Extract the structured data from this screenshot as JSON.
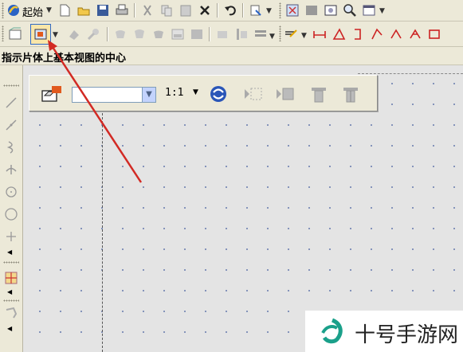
{
  "toolbar_top": {
    "start_label": "起始",
    "icons": [
      "nx-logo-icon",
      "new-file-icon",
      "open-folder-icon",
      "save-icon",
      "print-icon",
      "cut-icon",
      "copy-icon",
      "paste-icon",
      "delete-icon",
      "undo-icon",
      "command-finder-icon",
      "zoom-fit-icon",
      "layer-icon",
      "view-icon",
      "zoom-icon",
      "window-icon"
    ]
  },
  "toolbar_second": {
    "icons": [
      "new-sheet-icon",
      "base-view-icon",
      "projected-view-icon",
      "detail-view-icon",
      "section-view-icon",
      "break-view-icon",
      "view-boundary-icon",
      "view-dependent-icon",
      "view-update-icon",
      "display-sheet-icon",
      "view-style-icon",
      "property-icon",
      "arrange-icon",
      "annotation-icon",
      "dimension-icon",
      "datum-icon",
      "gdt-icon",
      "symbol-icon",
      "weld-icon",
      "more-icon"
    ]
  },
  "prompt": {
    "text": "指示片体上基本视图的中心"
  },
  "floatbar": {
    "scale_value": "",
    "ratio_label": "1:1",
    "icons": [
      "base-view-create-icon",
      "orient-view-icon",
      "style-icon",
      "move-icon",
      "section-icon",
      "section-icon-2"
    ]
  },
  "left_tools": [
    "line-icon",
    "polyline-icon",
    "spline-icon",
    "point-icon",
    "circle-icon",
    "circle-2-icon",
    "cross-icon",
    "expand-icon",
    "grid-icon",
    "expand-icon-2",
    "curve-icon",
    "expand-icon-3"
  ],
  "watermark": {
    "text": "十号手游网"
  },
  "colors": {
    "arrow": "#d22a24",
    "background": "#ece9d8",
    "canvas": "#e4e4e4",
    "grid_dot": "#6c7fb0"
  }
}
